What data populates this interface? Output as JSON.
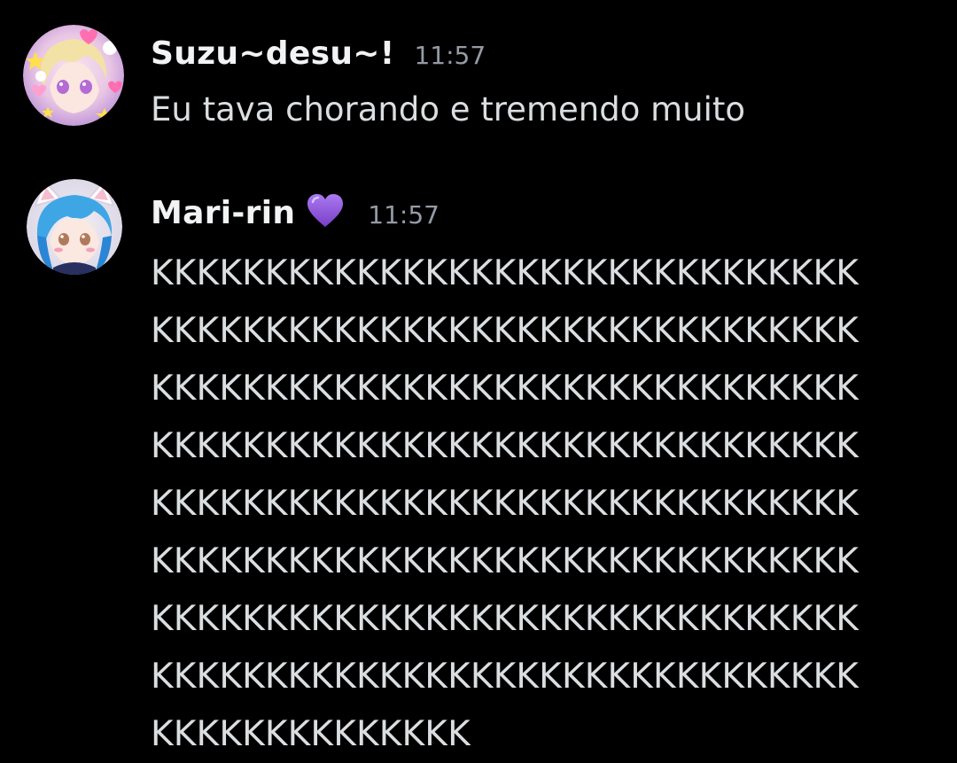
{
  "messages": [
    {
      "username": "Suzu~desu~!",
      "timestamp": "11:57",
      "text": "Eu tava chorando e tremendo muito"
    },
    {
      "username": "Mari-rin",
      "badge_icon": "purple-heart-icon",
      "badge_color": "#8a4bd8",
      "timestamp": "11:57",
      "lines": [
        "KKKKKKKKKKKKKKKKKKKKKKKKKKKKKKK",
        "KKKKKKKKKKKKKKKKKKKKKKKKKKKKKKK",
        "KKKKKKKKKKKKKKKKKKKKKKKKKKKKKKK",
        "KKKKKKKKKKKKKKKKKKKKKKKKKKKKKKK",
        "KKKKKKKKKKKKKKKKKKKKKKKKKKKKKKK",
        "KKKKKKKKKKKKKKKKKKKKKKKKKKKKKKK",
        "KKKKKKKKKKKKKKKKKKKKKKKKKKKKKKK",
        "KKKKKKKKKKKKKKKKKKKKKKKKKKKKKKK",
        "KKKKKKKKKKKKKK"
      ]
    }
  ],
  "colors": {
    "background": "#000000",
    "username": "#f2f3f5",
    "timestamp": "#949ba4",
    "text": "#dbdee1"
  }
}
